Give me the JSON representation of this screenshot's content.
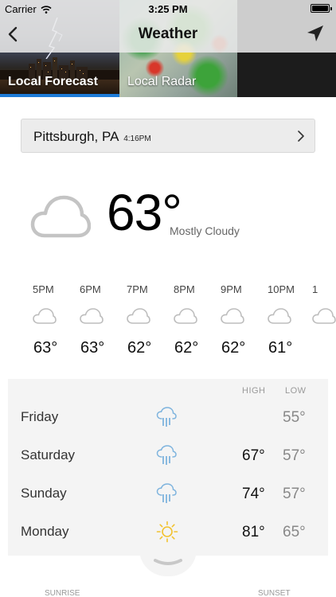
{
  "status_bar": {
    "carrier": "Carrier",
    "time": "3:25 PM"
  },
  "nav": {
    "title": "Weather",
    "back_icon": "chevron-left-icon",
    "location_icon": "location-arrow-icon"
  },
  "tabs": [
    {
      "label": "Local Forecast",
      "selected": true
    },
    {
      "label": "Local Radar",
      "selected": false
    }
  ],
  "location": {
    "city": "Pittsburgh, PA",
    "updated": "4:16PM"
  },
  "current": {
    "temp": "63°",
    "condition": "Mostly Cloudy",
    "icon": "cloud-icon"
  },
  "hourly": [
    {
      "time": "5PM",
      "temp": "63°",
      "icon": "cloud-icon"
    },
    {
      "time": "6PM",
      "temp": "63°",
      "icon": "cloud-icon"
    },
    {
      "time": "7PM",
      "temp": "62°",
      "icon": "cloud-icon"
    },
    {
      "time": "8PM",
      "temp": "62°",
      "icon": "cloud-icon"
    },
    {
      "time": "9PM",
      "temp": "62°",
      "icon": "cloud-icon"
    },
    {
      "time": "10PM",
      "temp": "61°",
      "icon": "cloud-icon"
    },
    {
      "time": "1",
      "temp": "",
      "icon": "cloud-icon"
    }
  ],
  "daily": {
    "high_label": "HIGH",
    "low_label": "LOW",
    "days": [
      {
        "day": "Friday",
        "high": "",
        "low": "55°",
        "icon": "rain-cloud-icon"
      },
      {
        "day": "Saturday",
        "high": "67°",
        "low": "57°",
        "icon": "rain-cloud-icon"
      },
      {
        "day": "Sunday",
        "high": "74°",
        "low": "57°",
        "icon": "rain-cloud-icon"
      },
      {
        "day": "Monday",
        "high": "81°",
        "low": "65°",
        "icon": "sun-icon"
      }
    ]
  },
  "bottom": {
    "sunrise_label": "SUNRISE",
    "sunset_label": "SUNSET"
  },
  "colors": {
    "accent": "#1d7bd8",
    "sun": "#f2c22e",
    "rain": "#7fb4de",
    "cloud": "#bdbdbd"
  }
}
